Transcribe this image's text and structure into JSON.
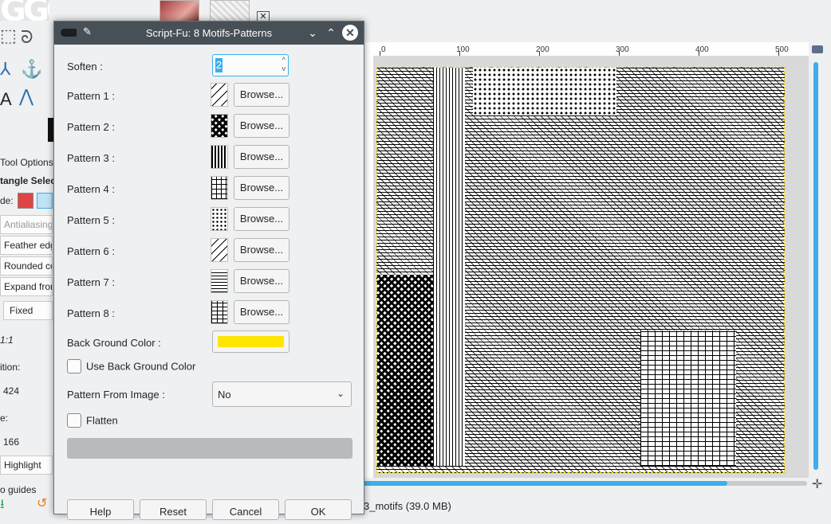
{
  "dialog": {
    "title": "Script-Fu: 8 Motifs-Patterns",
    "soften_label": "Soften :",
    "soften_value": "2",
    "patterns": [
      {
        "label": "Pattern 1 :",
        "browse": "Browse..."
      },
      {
        "label": "Pattern 2 :",
        "browse": "Browse..."
      },
      {
        "label": "Pattern 3 :",
        "browse": "Browse..."
      },
      {
        "label": "Pattern 4 :",
        "browse": "Browse..."
      },
      {
        "label": "Pattern 5 :",
        "browse": "Browse..."
      },
      {
        "label": "Pattern 6 :",
        "browse": "Browse..."
      },
      {
        "label": "Pattern 7 :",
        "browse": "Browse..."
      },
      {
        "label": "Pattern 8 :",
        "browse": "Browse..."
      }
    ],
    "bg_color_label": "Back Ground Color :",
    "bg_color": "#ffe600",
    "use_bg_color_label": "Use Back Ground Color",
    "use_bg_color_checked": false,
    "pattern_from_image_label": "Pattern From Image :",
    "pattern_from_image_value": "No",
    "flatten_label": "Flatten",
    "flatten_checked": false,
    "buttons": {
      "help": "Help",
      "reset": "Reset",
      "cancel": "Cancel",
      "ok": "OK"
    }
  },
  "tool_options": {
    "title": "Tool Options",
    "tool_name": "tangle Selec",
    "mode_label": "de:",
    "antialiasing": "Antialiasing",
    "feather": "Feather edg",
    "rounded": "Rounded co",
    "expand": "Expand from",
    "fixed": "Fixed",
    "ratio": "1:1",
    "position_label": "ition:",
    "position_value": "424",
    "size_label": "e:",
    "size_value": "166",
    "highlight": "Highlight",
    "guides": "o guides"
  },
  "canvas": {
    "ruler_ticks": [
      "0",
      "100",
      "200",
      "300",
      "400",
      "500"
    ],
    "status": "3_motifs (39.0 MB)"
  },
  "colors": {
    "accent": "#3daee9",
    "titlebar": "#475057"
  }
}
